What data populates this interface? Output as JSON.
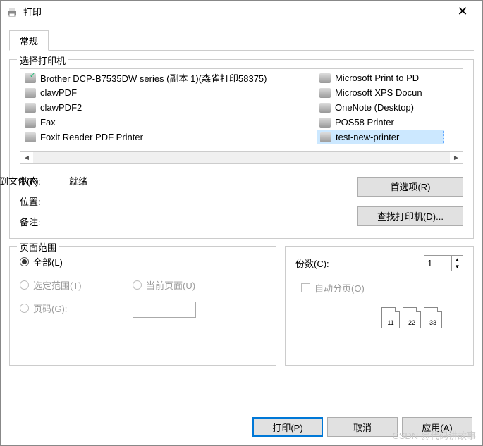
{
  "titlebar": {
    "title": "打印"
  },
  "tabs": {
    "general": "常规"
  },
  "group": {
    "printer_select": "选择打印机",
    "range": "页面范围"
  },
  "printers": {
    "col1": [
      "Brother DCP-B7535DW series (副本 1)(森雀打印58375)",
      "clawPDF",
      "clawPDF2",
      "Fax",
      "Foxit Reader PDF Printer"
    ],
    "col2": [
      "Microsoft Print to PD",
      "Microsoft XPS Docun",
      "OneNote (Desktop)",
      "POS58 Printer",
      "test-new-printer"
    ],
    "selected_index_col2": 4
  },
  "status": {
    "status_label": "状态:",
    "status_value": "就绪",
    "location_label": "位置:",
    "location_value": "",
    "comment_label": "备注:",
    "comment_value": "",
    "print_to_file": "打印到文件(F)",
    "preferences": "首选项(R)",
    "find_printer": "查找打印机(D)..."
  },
  "range": {
    "all": "全部(L)",
    "selection": "选定范围(T)",
    "current_page": "当前页面(U)",
    "pages": "页码(G):"
  },
  "copies": {
    "label": "份数(C):",
    "value": "1",
    "collate": "自动分页(O)",
    "pagelabels": [
      "11",
      "22",
      "33"
    ]
  },
  "footer": {
    "print": "打印(P)",
    "cancel": "取消",
    "apply": "应用(A)"
  },
  "watermark": "CSDN @代码讲故事"
}
